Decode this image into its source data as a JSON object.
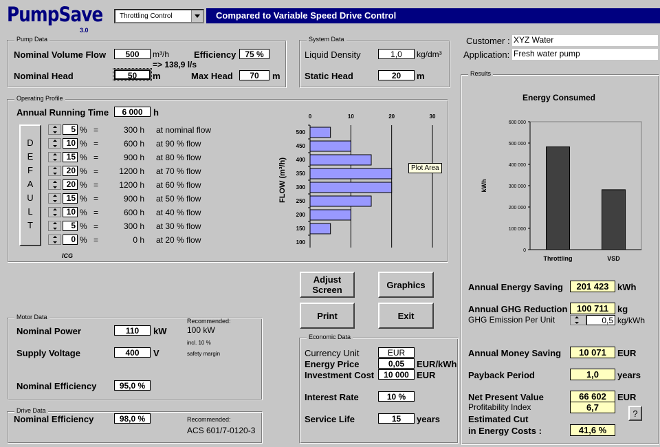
{
  "app": {
    "logo": "PumpSave",
    "version": "3.0",
    "mode_select": "Throttling Control",
    "banner": "Compared to Variable Speed Drive Control",
    "footer_logo": "ICG"
  },
  "colors": {
    "banner": "#000080",
    "bar_fill": "#9999ff",
    "bar_dark": "#404040",
    "result_yellow": "#ffffc0",
    "background": "#c6c6c6"
  },
  "pump": {
    "title": "Pump Data",
    "volume_flow_label": "Nominal Volume Flow",
    "volume_flow": "500",
    "volume_flow_unit": "m³/h",
    "flow_ls": "=> 138,9 l/s",
    "efficiency_label": "Efficiency",
    "efficiency": "75 %",
    "head_label": "Nominal Head",
    "head": "50",
    "head_unit": "m",
    "max_head_label": "Max Head",
    "max_head": "70",
    "max_head_unit": "m"
  },
  "system": {
    "title": "System Data",
    "density_label": "Liquid Density",
    "density": "1,0",
    "density_unit": "kg/dm³",
    "static_head_label": "Static Head",
    "static_head": "20",
    "static_head_unit": "m"
  },
  "customer": {
    "customer_label": "Customer :",
    "customer": "XYZ Water",
    "application_label": "Application:",
    "application": "Fresh water pump"
  },
  "profile": {
    "title": "Operating Profile",
    "running_label": "Annual Running Time",
    "running_time": "6 000",
    "running_unit": "h",
    "default_label": "DEFAULT",
    "rows": [
      {
        "pct": "5",
        "hours": "300 h",
        "at": "at nominal flow"
      },
      {
        "pct": "10",
        "hours": "600 h",
        "at": "at 90 % flow"
      },
      {
        "pct": "15",
        "hours": "900 h",
        "at": "at 80 % flow"
      },
      {
        "pct": "20",
        "hours": "1200 h",
        "at": "at 70 % flow"
      },
      {
        "pct": "20",
        "hours": "1200 h",
        "at": "at 60 % flow"
      },
      {
        "pct": "15",
        "hours": "900 h",
        "at": "at 50 % flow"
      },
      {
        "pct": "10",
        "hours": "600 h",
        "at": "at 40 % flow"
      },
      {
        "pct": "5",
        "hours": "300 h",
        "at": "at 30 % flow"
      },
      {
        "pct": "0",
        "hours": "0 h",
        "at": "at 20 % flow"
      }
    ],
    "pct_sym": "%",
    "eq_sym": "=",
    "tooltip": "Plot Area"
  },
  "chart_data": [
    {
      "type": "bar",
      "orientation": "horizontal",
      "ylabel": "FLOW (m³/h)",
      "categories": [
        "500",
        "450",
        "400",
        "350",
        "300",
        "250",
        "200",
        "150",
        "100"
      ],
      "values": [
        5,
        10,
        15,
        20,
        20,
        15,
        10,
        5,
        0
      ],
      "xticks": [
        "0",
        "10",
        "20",
        "30"
      ],
      "xlim": [
        0,
        30
      ]
    },
    {
      "type": "bar",
      "title": "Energy Consumed",
      "ylabel": "kWh",
      "categories": [
        "Throttling",
        "VSD"
      ],
      "values": [
        482000,
        281000
      ],
      "yticks": [
        "600 000",
        "500 000",
        "400 000",
        "300 000",
        "200 000",
        "100 000",
        "0"
      ],
      "ylim": [
        0,
        600000
      ]
    }
  ],
  "results_title": "Results",
  "buttons": {
    "adjust": "Adjust Screen",
    "graphics": "Graphics",
    "print": "Print",
    "exit": "Exit",
    "help": "?"
  },
  "motor": {
    "title": "Motor Data",
    "power_label": "Nominal Power",
    "power": "110",
    "power_unit": "kW",
    "voltage_label": "Supply Voltage",
    "voltage": "400",
    "voltage_unit": "V",
    "eff_label": "Nominal Efficiency",
    "eff": "95,0 %",
    "rec_label": "Recommended:",
    "rec_value": "100 kW",
    "rec_note1": "incl. 10 %",
    "rec_note2": "safety margin"
  },
  "drive": {
    "title": "Drive Data",
    "eff_label": "Nominal Efficiency",
    "eff": "98,0 %",
    "rec_label": "Recommended:",
    "rec_value": "ACS 601/7-0120-3"
  },
  "economic": {
    "title": "Economic Data",
    "currency_label": "Currency Unit",
    "currency": "EUR",
    "price_label": "Energy Price",
    "price": "0,05",
    "price_unit": "EUR/kWh",
    "invest_label": "Investment Cost",
    "invest": "10 000",
    "invest_unit": "EUR",
    "interest_label": "Interest Rate",
    "interest": "10 %",
    "life_label": "Service Life",
    "life": "15",
    "life_unit": "years"
  },
  "results": {
    "energy_saving_label": "Annual Energy Saving",
    "energy_saving": "201 423",
    "energy_saving_unit": "kWh",
    "ghg_label": "Annual GHG Reduction",
    "ghg": "100 711",
    "ghg_unit": "kg",
    "ghg_factor_label": "GHG Emission Per Unit",
    "ghg_factor": "0,5",
    "ghg_factor_unit": "kg/kWh",
    "money_label": "Annual Money Saving",
    "money": "10 071",
    "money_unit": "EUR",
    "payback_label": "Payback Period",
    "payback": "1,0",
    "payback_unit": "years",
    "npv_label": "Net Present Value",
    "npv": "66 602",
    "npv_unit": "EUR",
    "pi_label": "Profitability Index",
    "pi": "6,7",
    "cut_label1": "Estimated Cut",
    "cut_label2": "in Energy Costs :",
    "cut": "41,6 %"
  }
}
